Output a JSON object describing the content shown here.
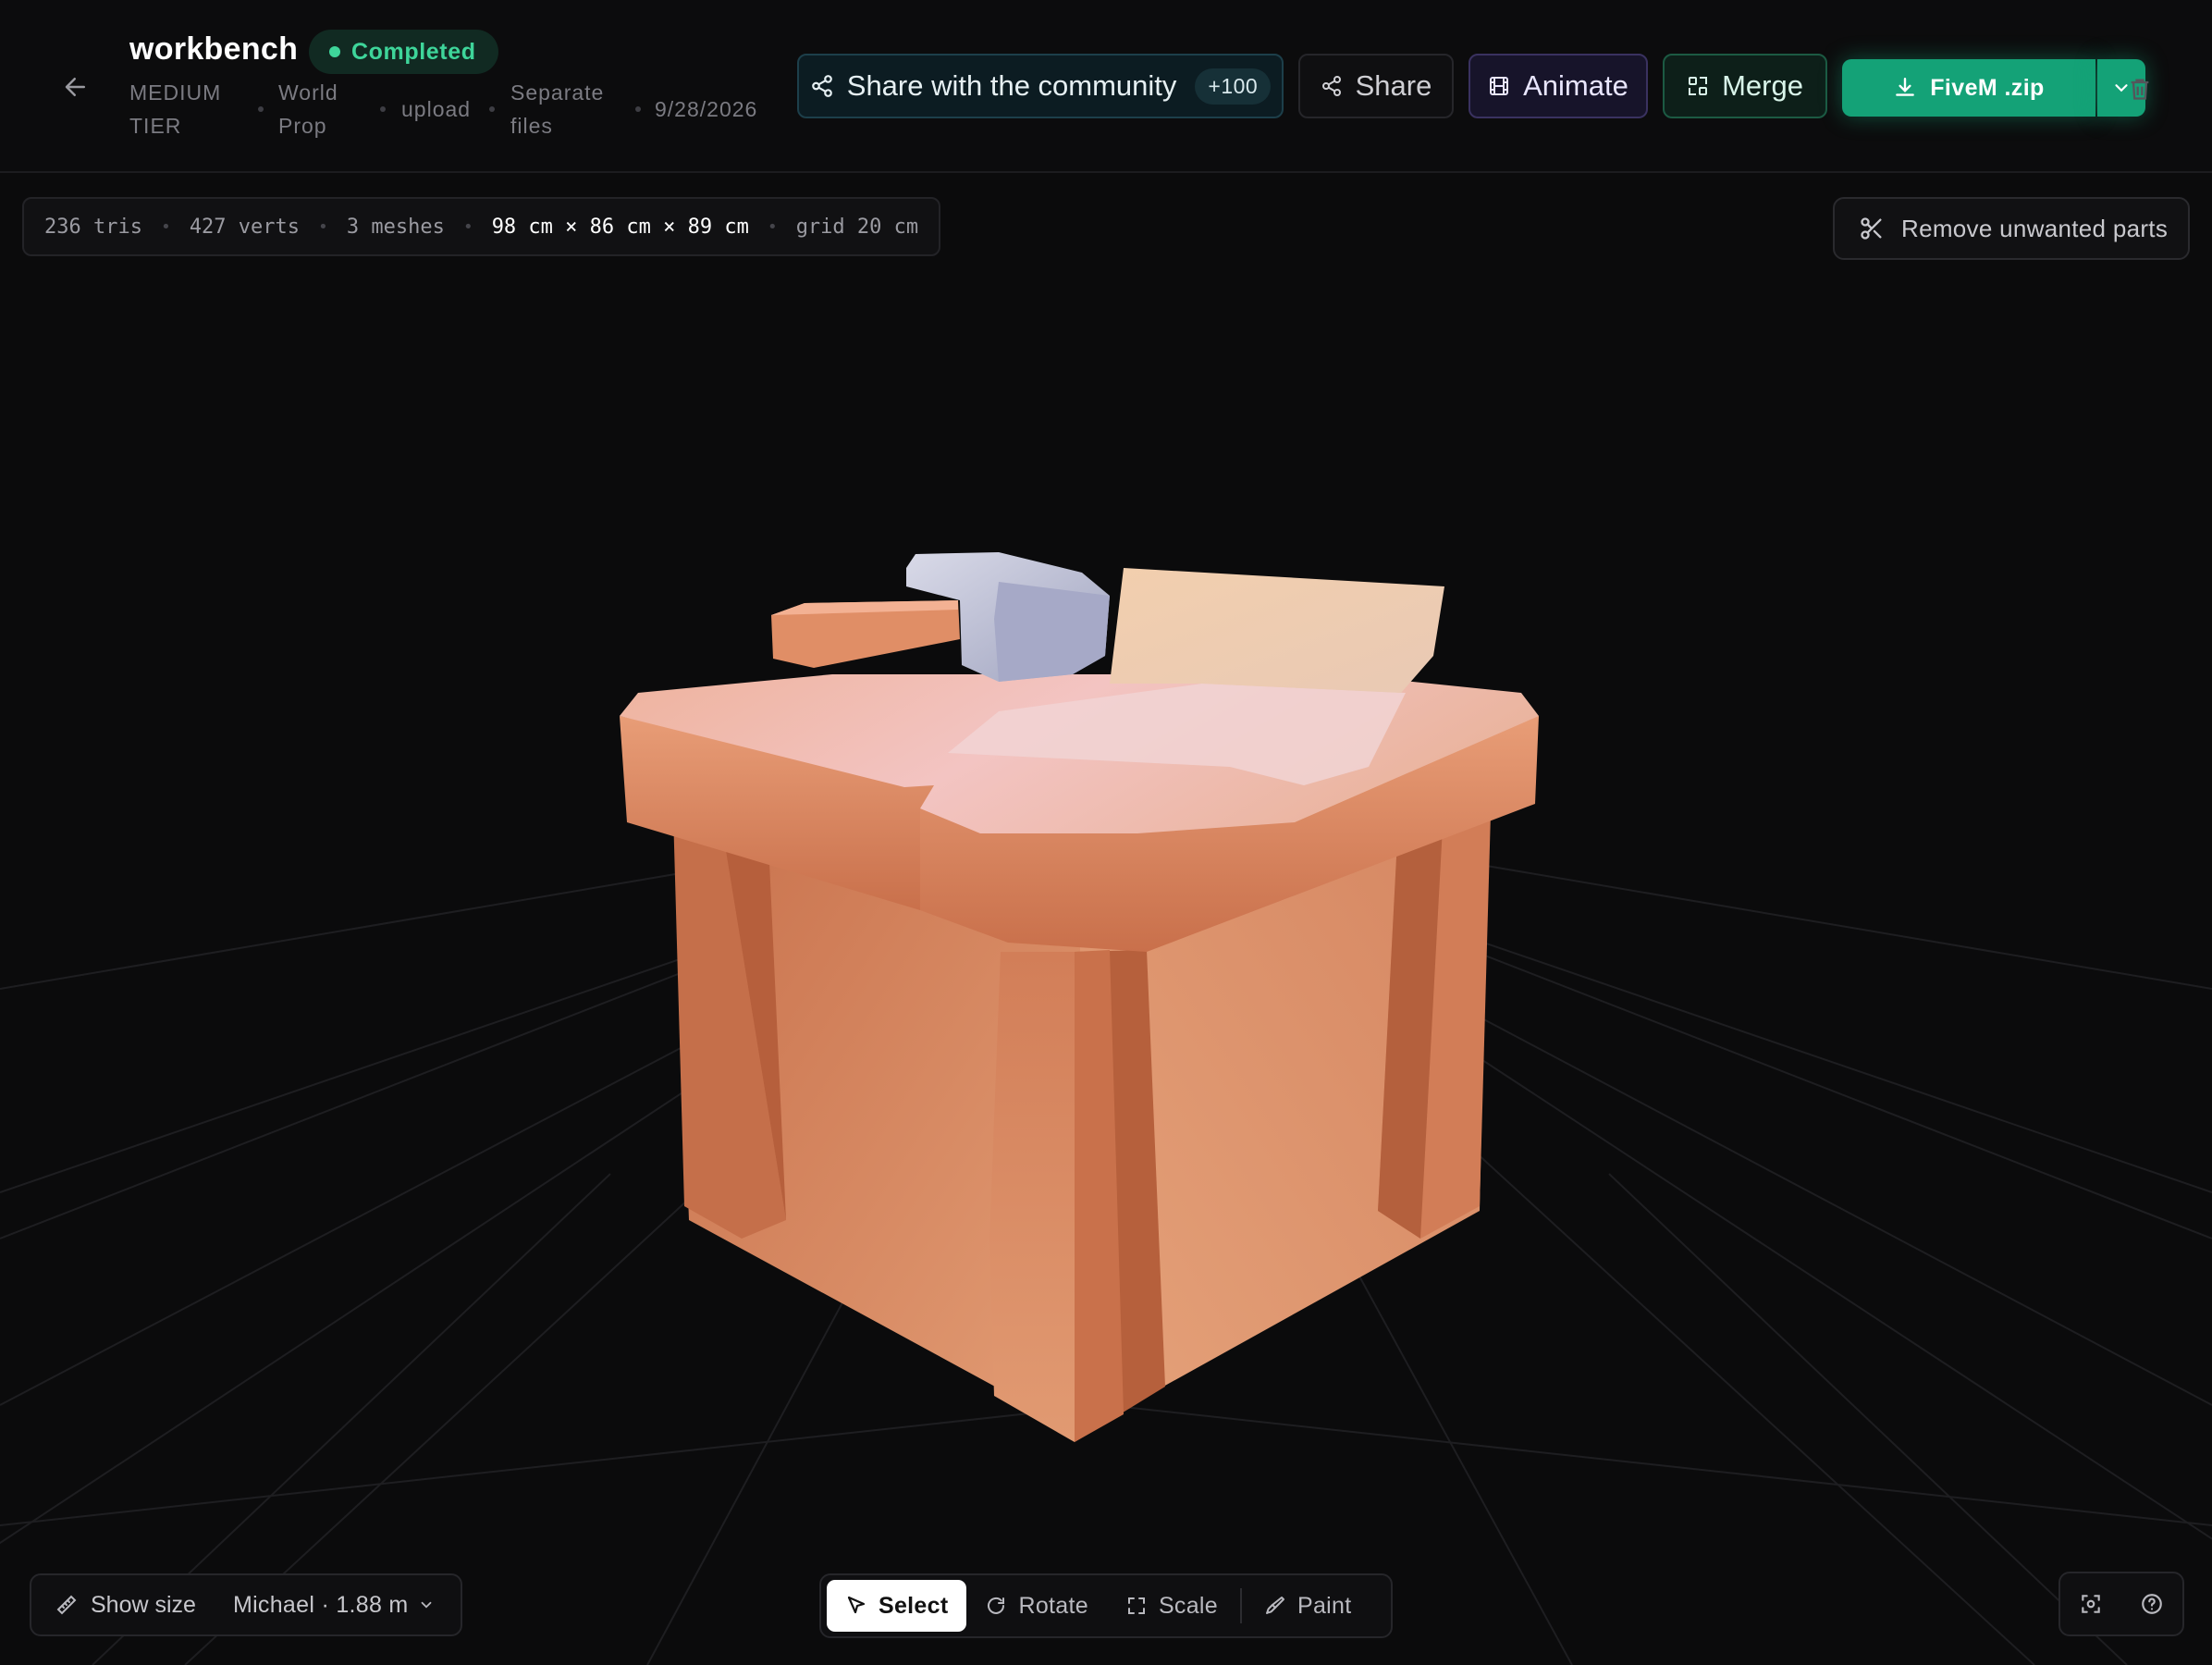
{
  "header": {
    "title": "workbench",
    "status": "Completed",
    "meta": {
      "tier_line1": "MEDIUM",
      "tier_line2": "TIER",
      "category_line1": "World",
      "category_line2": "Prop",
      "source": "upload",
      "output_line1": "Separate",
      "output_line2": "files",
      "date": "9/28/2026"
    },
    "buttons": {
      "community_label": "Share with the community",
      "community_count": "+100",
      "share_label": "Share",
      "animate_label": "Animate",
      "merge_label": "Merge",
      "download_label": "FiveM .zip"
    }
  },
  "stats": {
    "tris": "236 tris",
    "verts": "427 verts",
    "meshes": "3 meshes",
    "dimensions": "98 cm × 86 cm × 89 cm",
    "grid": "grid 20 cm"
  },
  "actions": {
    "remove_parts_label": "Remove unwanted parts"
  },
  "size_panel": {
    "toggle_label": "Show size",
    "reference_selected": "Michael · 1.88 m"
  },
  "toolbar": {
    "select_label": "Select",
    "rotate_label": "Rotate",
    "scale_label": "Scale",
    "paint_label": "Paint",
    "active_tool": "Select"
  },
  "icons": {
    "back": "arrow-left-icon",
    "share_node": "share-nodes-icon",
    "animate": "film-icon",
    "merge": "merge-icon",
    "download": "download-icon",
    "caret": "chevron-down-icon",
    "delete": "trash-icon",
    "scissors": "scissors-icon",
    "ruler": "ruler-icon",
    "cursor": "cursor-icon",
    "rotate": "rotate-icon",
    "scale": "scale-icon",
    "paint": "paint-icon",
    "focus": "focus-icon",
    "help": "help-icon"
  },
  "colors": {
    "accent_green": "#14a277",
    "status_green": "#3ed59a",
    "background": "#0b0b0c"
  }
}
